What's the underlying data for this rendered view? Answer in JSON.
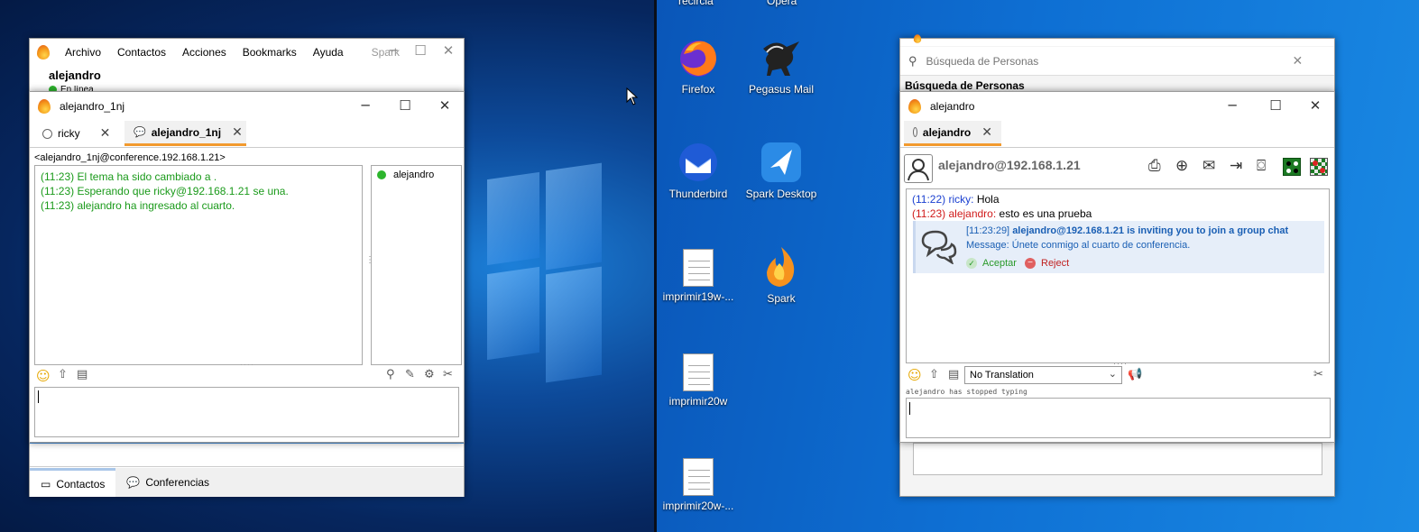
{
  "desktop": {
    "cursor_visible": true,
    "top_partial_labels": [
      "recircla",
      "Opera"
    ],
    "icons": [
      {
        "label": "Firefox"
      },
      {
        "label": "Pegasus Mail"
      },
      {
        "label": "Thunderbird"
      },
      {
        "label": "Spark Desktop"
      },
      {
        "label": "imprimir19w-..."
      },
      {
        "label": "Spark"
      },
      {
        "label": "imprimir20w"
      },
      {
        "label": "imprimir20w-..."
      }
    ]
  },
  "spark_main": {
    "menu": [
      "Archivo",
      "Contactos",
      "Acciones",
      "Bookmarks",
      "Ayuda"
    ],
    "app_label": "Spark",
    "user_name": "alejandro",
    "status_text": "En línea",
    "bottom_tabs": [
      "Contactos",
      "Conferencias"
    ]
  },
  "room_window": {
    "title": "alejandro_1nj",
    "tabs": [
      {
        "label": "ricky"
      },
      {
        "label": "alejandro_1nj"
      }
    ],
    "room_jid": "<alejandro_1nj@conference.192.168.1.21>",
    "messages": [
      "(11:23) El tema ha sido cambiado a .",
      "(11:23) Esperando que ricky@192.168.1.21 se una.",
      "(11:23) alejandro ha ingresado al cuarto."
    ],
    "participants": [
      "alejandro"
    ],
    "input_value": ""
  },
  "search_window": {
    "placeholder": "Búsqueda de Personas",
    "section_title": "Búsqueda de Personas"
  },
  "chat_window": {
    "title": "alejandro",
    "tab_label": "alejandro",
    "contact_jid": "alejandro@192.168.1.21",
    "messages": [
      {
        "time": "(11:22)",
        "sender": "ricky:",
        "text": "Hola",
        "time_color": "#1a3fd0",
        "sender_color": "#1a3fd0"
      },
      {
        "time": "(11:23)",
        "sender": "alejandro:",
        "text": "esto es una prueba",
        "time_color": "#d01a1a",
        "sender_color": "#d01a1a"
      }
    ],
    "invite": {
      "time": "[11:23:29]",
      "text": "alejandro@192.168.1.21 is inviting you to join a group chat",
      "message": "Message: Únete conmigo al cuarto de conferencia.",
      "accept_label": "Aceptar",
      "reject_label": "Reject"
    },
    "translation_select": "No Translation",
    "typing_status": "alejandro has stopped typing",
    "input_value": ""
  }
}
